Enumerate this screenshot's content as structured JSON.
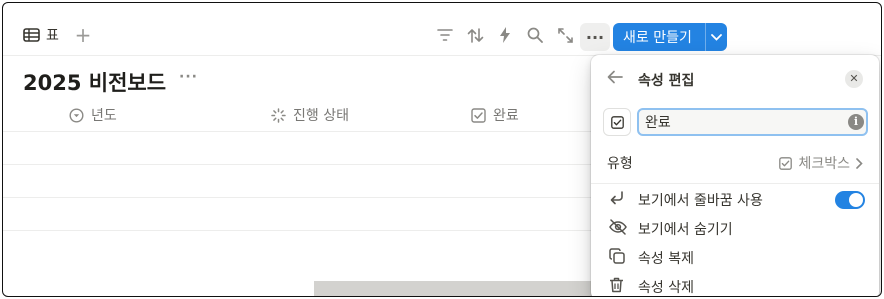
{
  "toolbar": {
    "view_tab_label": "표",
    "new_button_label": "새로 만들기",
    "icons": [
      "filter-icon",
      "sort-icon",
      "automation-icon",
      "search-icon",
      "expand-icon",
      "more-icon"
    ]
  },
  "database": {
    "title": "2025 비전보드",
    "columns": [
      {
        "label": "년도",
        "icon": "select-icon"
      },
      {
        "label": "진행 상태",
        "icon": "status-icon"
      },
      {
        "label": "완료",
        "icon": "checkbox-icon"
      }
    ]
  },
  "panel": {
    "title": "속성 편집",
    "property_name": "완료",
    "type_label": "유형",
    "type_value": "체크박스",
    "menu": [
      {
        "label": "보기에서 줄바꿈 사용",
        "icon": "wrap-icon",
        "toggle": true
      },
      {
        "label": "보기에서 숨기기",
        "icon": "eye-slash-icon"
      },
      {
        "label": "속성 복제",
        "icon": "duplicate-icon"
      },
      {
        "label": "속성 삭제",
        "icon": "trash-icon"
      }
    ]
  },
  "colors": {
    "accent": "#2383e2",
    "text": "#37352f",
    "muted": "#787774"
  }
}
